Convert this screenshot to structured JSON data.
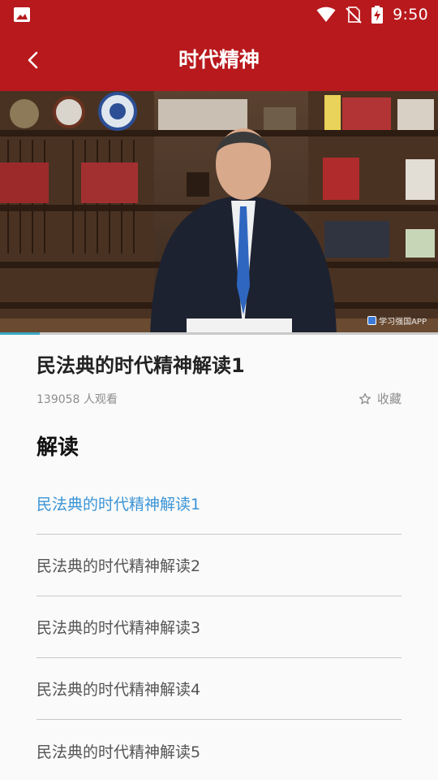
{
  "status_bar": {
    "time": "9:50",
    "icons": [
      "gallery-icon",
      "wifi-icon",
      "no-sim-icon",
      "battery-charging-icon"
    ]
  },
  "app_bar": {
    "title": "时代精神",
    "back_icon": "chevron-left-icon"
  },
  "video": {
    "watermark": "学习强国APP",
    "progress": 0.09,
    "accent_color": "#3aa6c2"
  },
  "detail": {
    "title": "民法典的时代精神解读1",
    "views": "139058 人观看",
    "favorite_label": "收藏",
    "favorite_icon": "star-outline-icon"
  },
  "section": {
    "heading": "解读"
  },
  "episodes": [
    {
      "label": "民法典的时代精神解读1",
      "active": true
    },
    {
      "label": "民法典的时代精神解读2",
      "active": false
    },
    {
      "label": "民法典的时代精神解读3",
      "active": false
    },
    {
      "label": "民法典的时代精神解读4",
      "active": false
    },
    {
      "label": "民法典的时代精神解读5",
      "active": false
    }
  ],
  "colors": {
    "brand_red": "#b8191c",
    "active_item": "#3a94d6",
    "text_muted": "#8d8d8d"
  }
}
